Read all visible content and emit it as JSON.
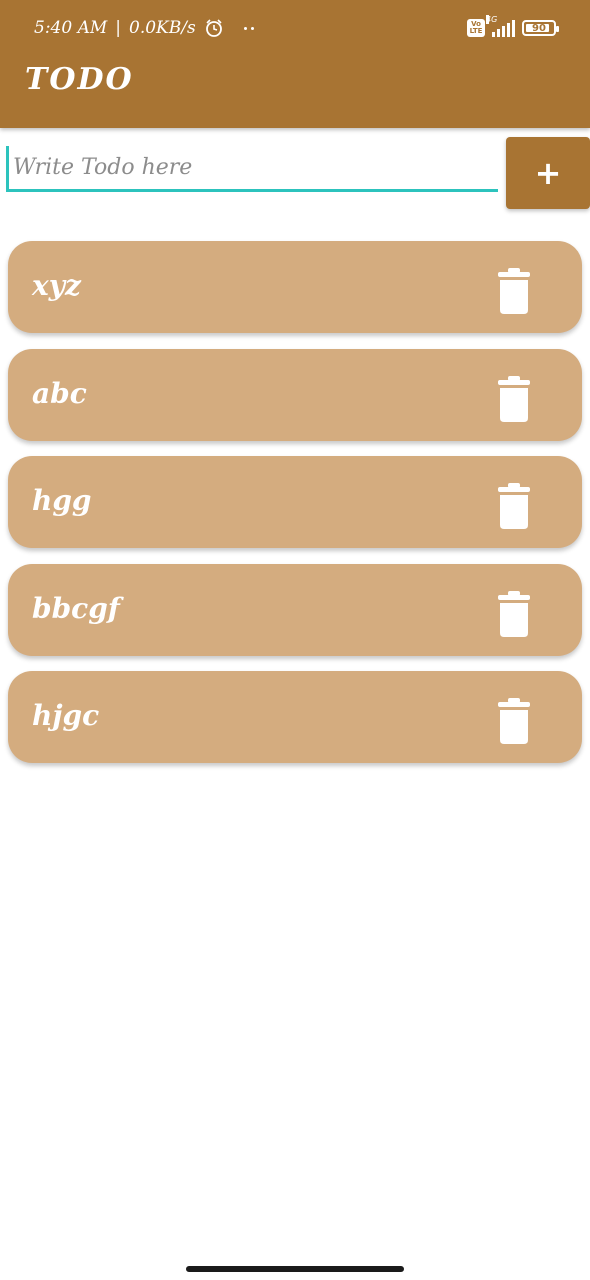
{
  "status_bar": {
    "time": "5:40 AM",
    "speed": "0.0KB/s",
    "network_type": "4G",
    "volte_top": "Vo",
    "volte_bottom": "LTE",
    "battery_level": "90",
    "battery_fraction": 0.9,
    "icons": [
      "alarm-icon",
      "dots-icon",
      "volte-icon",
      "signal-icon",
      "battery-icon"
    ]
  },
  "app": {
    "title": "TODO",
    "accent_color": "#a87433",
    "card_color": "#d4ac7f",
    "input_underline_color": "#2cc3bd"
  },
  "input": {
    "placeholder": "Write Todo here",
    "value": "",
    "add_label": "+"
  },
  "todos": [
    {
      "text": "xyz",
      "delete_icon": "trash-icon"
    },
    {
      "text": "abc",
      "delete_icon": "trash-icon"
    },
    {
      "text": "hgg",
      "delete_icon": "trash-icon"
    },
    {
      "text": "bbcgf",
      "delete_icon": "trash-icon"
    },
    {
      "text": "hjgc",
      "delete_icon": "trash-icon"
    }
  ]
}
